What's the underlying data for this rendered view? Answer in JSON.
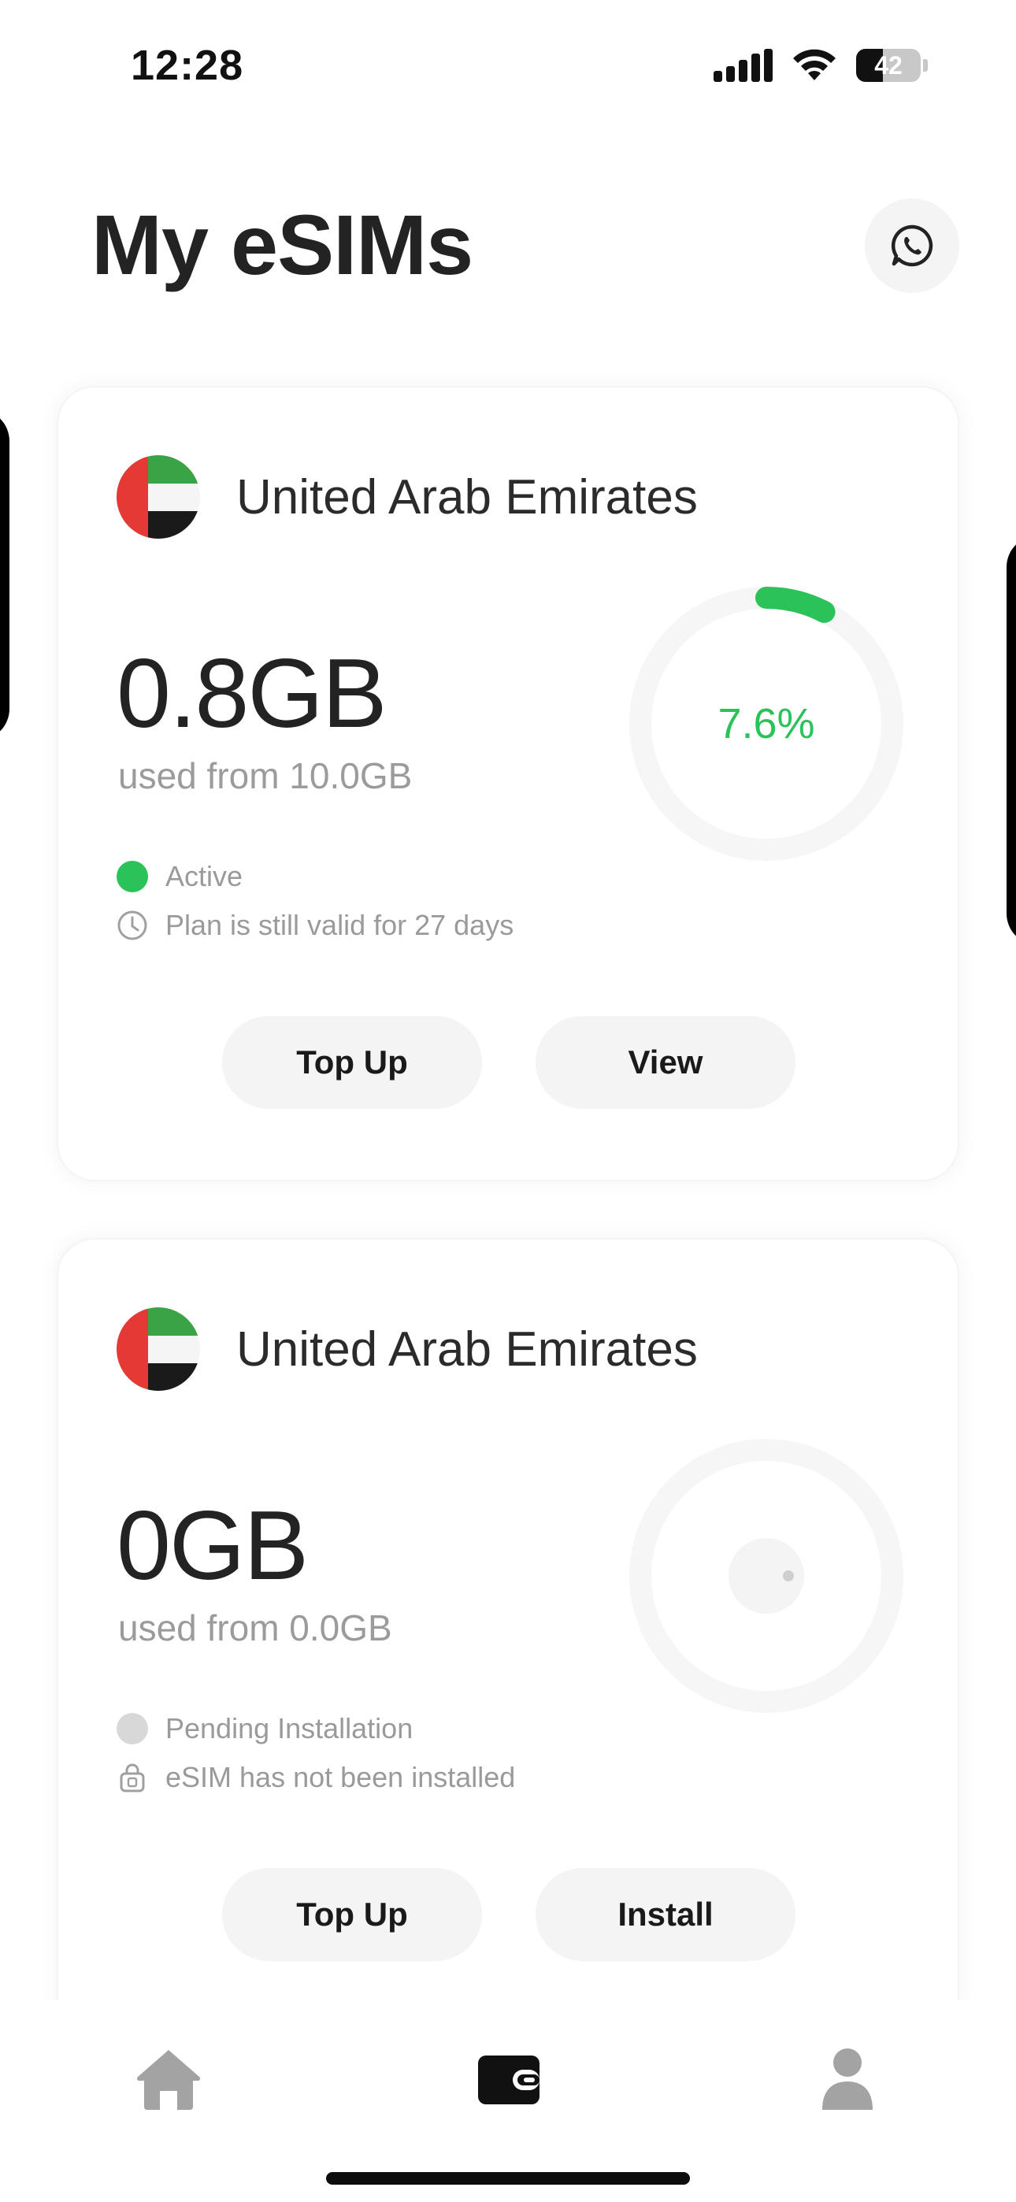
{
  "status_bar": {
    "time": "12:28",
    "battery": "42"
  },
  "header": {
    "title": "My eSIMs",
    "chat_icon": "whatsapp-icon"
  },
  "esims": [
    {
      "country": "United Arab Emirates",
      "used": "0.8GB",
      "used_from": "used from 10.0GB",
      "usage_percent_label": "7.6%",
      "usage_fraction": 0.076,
      "status": "Active",
      "status_color": "#2bc25a",
      "detail": "Plan is still valid for 27 days",
      "detail_icon": "clock-icon",
      "buttons": [
        "Top Up",
        "View"
      ]
    },
    {
      "country": "United Arab Emirates",
      "used": "0GB",
      "used_from": "used from 0.0GB",
      "usage_fraction": 0,
      "status": "Pending Installation",
      "status_color": "#d8d8d8",
      "detail": "eSIM has not been installed",
      "detail_icon": "sim-lock-icon",
      "buttons": [
        "Top Up",
        "Install"
      ]
    }
  ],
  "bottom_nav": {
    "items": [
      {
        "icon": "home-icon",
        "active": false
      },
      {
        "icon": "wallet-icon",
        "active": true
      },
      {
        "icon": "profile-icon",
        "active": false
      }
    ]
  },
  "colors": {
    "accent_green": "#2bc25a",
    "ring_track": "#f6f6f7",
    "button_bg": "#f4f4f5"
  }
}
